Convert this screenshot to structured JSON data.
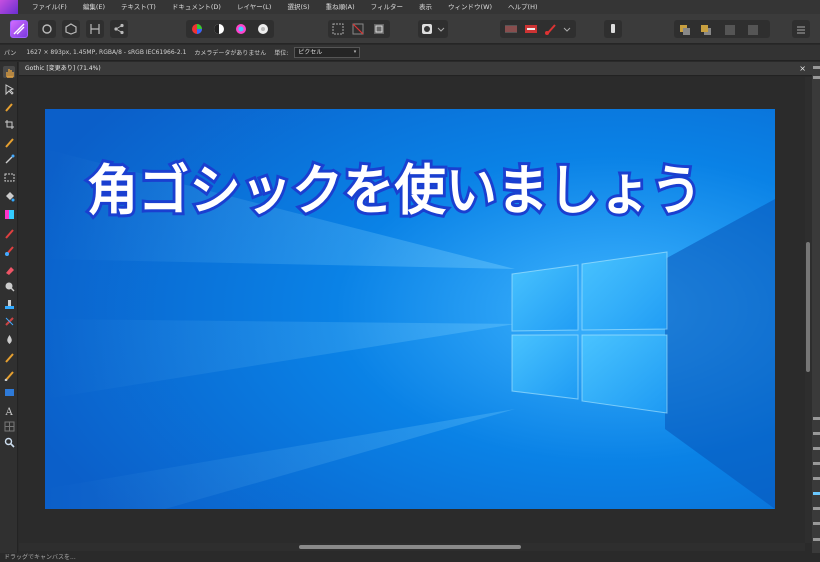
{
  "menu": {
    "items": [
      "ファイル(F)",
      "編集(E)",
      "テキスト(T)",
      "ドキュメント(D)",
      "レイヤー(L)",
      "選択(S)",
      "重ね順(A)",
      "フィルター",
      "表示",
      "ウィンドウ(W)",
      "ヘルプ(H)"
    ]
  },
  "context": {
    "tool_name": "パン",
    "doc_info": "1627 × 893px, 1.45MP, RGBA/8 - sRGB IEC61966-2.1",
    "camera": "カメラデータがありません",
    "unit_label": "単位:",
    "unit_value": "ピクセル"
  },
  "document": {
    "tab_title": "Gothic [変更あり] (71.4%)",
    "close_glyph": "×",
    "headline": "角ゴシックを使いましょう"
  },
  "status": {
    "text": "ドラッグでキャンバスを..."
  },
  "colors": {
    "accent": "#b04cf0",
    "canvas_bg": "#0b74d8",
    "headline_fill": "#ffffff",
    "headline_stroke": "#1a3fd0"
  }
}
